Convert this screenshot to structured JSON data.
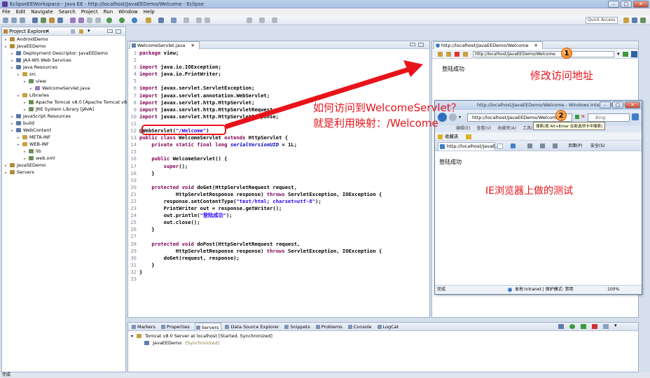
{
  "window": {
    "title": "EclipseEEWorkspace - Java EE - http://localhost/JavaEEDemo/Welcome - Eclipse"
  },
  "menu": [
    "File",
    "Edit",
    "Navigate",
    "Search",
    "Project",
    "Run",
    "Window",
    "Help"
  ],
  "toolbar": {
    "quick_access": "Quick Access"
  },
  "explorer": {
    "title": "Project Explorer",
    "items": [
      {
        "label": "AndroidDemo",
        "indent": 0
      },
      {
        "label": "JavaEEDemo",
        "indent": 0
      },
      {
        "label": "Deployment Descriptor: JavaEEDemo",
        "indent": 1
      },
      {
        "label": "JAX-WS Web Services",
        "indent": 1
      },
      {
        "label": "Java Resources",
        "indent": 1
      },
      {
        "label": "src",
        "indent": 2
      },
      {
        "label": "view",
        "indent": 3
      },
      {
        "label": "WelcomeServlet.java",
        "indent": 4
      },
      {
        "label": "Libraries",
        "indent": 2
      },
      {
        "label": "Apache Tomcat v8.0 [Apache Tomcat v8.0]",
        "indent": 3
      },
      {
        "label": "JRE System Library [JAVA]",
        "indent": 3
      },
      {
        "label": "JavaScript Resources",
        "indent": 1
      },
      {
        "label": "build",
        "indent": 1
      },
      {
        "label": "WebContent",
        "indent": 1
      },
      {
        "label": "META-INF",
        "indent": 2
      },
      {
        "label": "WEB-INF",
        "indent": 2
      },
      {
        "label": "lib",
        "indent": 3
      },
      {
        "label": "web.xml",
        "indent": 3
      },
      {
        "label": "JavaSEDemo",
        "indent": 0
      },
      {
        "label": "Servers",
        "indent": 0
      }
    ]
  },
  "editor": {
    "tab": "WelcomeServlet.java",
    "lines": [
      {
        "n": "1",
        "t": "package view;"
      },
      {
        "n": "2",
        "t": ""
      },
      {
        "n": "3",
        "t": "import java.io.IOException;"
      },
      {
        "n": "4",
        "t": "import java.io.PrintWriter;"
      },
      {
        "n": "5",
        "t": ""
      },
      {
        "n": "6",
        "t": "import javax.servlet.ServletException;"
      },
      {
        "n": "7",
        "t": "import javax.servlet.annotation.WebServlet;"
      },
      {
        "n": "8",
        "t": "import javax.servlet.http.HttpServlet;"
      },
      {
        "n": "9",
        "t": "import javax.servlet.http.HttpServletRequest;"
      },
      {
        "n": "10",
        "t": "import javax.servlet.http.HttpServletResponse;"
      },
      {
        "n": "11",
        "t": ""
      },
      {
        "n": "12",
        "t": "@WebServlet(\"/Welcome\")"
      },
      {
        "n": "13",
        "t": "public class WelcomeServlet extends HttpServlet {"
      },
      {
        "n": "14",
        "t": "    private static final long serialVersionUID = 1L;"
      },
      {
        "n": "15",
        "t": ""
      },
      {
        "n": "16",
        "t": "    public WelcomeServlet() {"
      },
      {
        "n": "17",
        "t": "        super();"
      },
      {
        "n": "18",
        "t": "    }"
      },
      {
        "n": "19",
        "t": ""
      },
      {
        "n": "20",
        "t": "    protected void doGet(HttpServletRequest request,"
      },
      {
        "n": "21",
        "t": "            HttpServletResponse response) throws ServletException, IOException {"
      },
      {
        "n": "22",
        "t": "        response.setContentType(\"text/html; charset=utf-8\");"
      },
      {
        "n": "23",
        "t": "        PrintWriter out = response.getWriter();"
      },
      {
        "n": "24",
        "t": "        out.println(\"登陆成功\");"
      },
      {
        "n": "25",
        "t": "        out.close();"
      },
      {
        "n": "26",
        "t": "    }"
      },
      {
        "n": "27",
        "t": ""
      },
      {
        "n": "28",
        "t": "    protected void doPost(HttpServletRequest request,"
      },
      {
        "n": "29",
        "t": "            HttpServletResponse response) throws ServletException, IOException {"
      },
      {
        "n": "30",
        "t": "        doGet(request, response);"
      },
      {
        "n": "31",
        "t": "    }"
      },
      {
        "n": "32",
        "t": "}"
      },
      {
        "n": "33",
        "t": ""
      }
    ]
  },
  "browser": {
    "tab": "http://localhost/JavaEEDemo/Welcome",
    "url": "http://localhost/JavaEEDemo/Welcome",
    "content": "登陆成功"
  },
  "ie": {
    "title": "http://localhost/JavaEEDemo/Welcome - Windows Internet Explorer",
    "url": "http://localhost/JavaEEDemo/Welcome",
    "search_placeholder": "Bing",
    "tooltip": "搜索(按 Alt+Enter 在新选项卡中搜索)",
    "menu": [
      "编辑(E)",
      "查看(V)",
      "收藏夹(A)",
      "工具(T)",
      "帮助(H)"
    ],
    "favorites": "收藏夹",
    "tab": "http://localhost/JavaE...",
    "page_button": "页面(P)",
    "safety_button": "安全(S)",
    "content": "登陆成功",
    "status_left": "完成",
    "status_zone": "本地 Intranet | 保护模式: 禁用",
    "zoom": "100%"
  },
  "annotations": {
    "label_modify": "修改访问地址",
    "label_question_1": "如何访问到WelcomeServlet？",
    "label_question_2": "就是利用映射：/Welcome",
    "label_ie_test": "IE浏览器上做的测试",
    "badge_1": "1",
    "badge_2": "2",
    "arrow_color": "#e8131a"
  },
  "bottom": {
    "tabs": [
      "Markers",
      "Properties",
      "Servers",
      "Data Source Explorer",
      "Snippets",
      "Problems",
      "Console",
      "LogCat"
    ],
    "active_tab": "Servers",
    "server": "Tomcat v8.0 Server at localhost  [Started, Synchronized]",
    "module": "JavaEEDemo",
    "module_state": "[Synchronized]"
  },
  "statusbar": {
    "text": "完成"
  }
}
